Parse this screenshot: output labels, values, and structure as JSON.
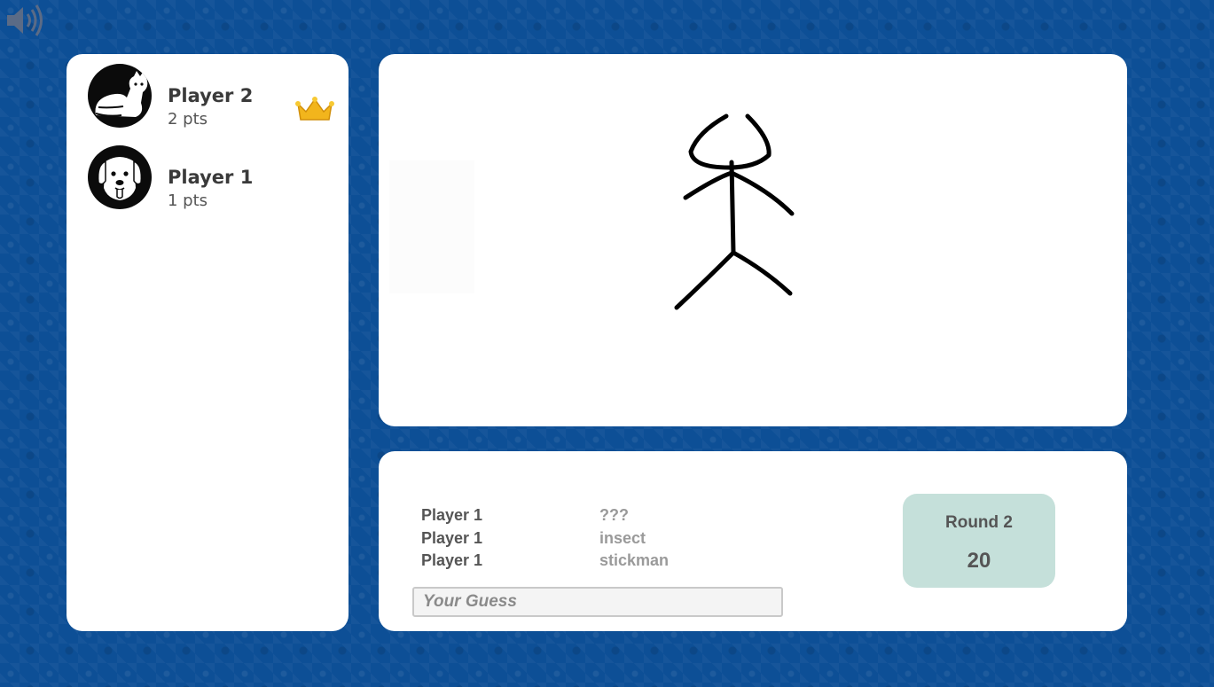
{
  "players": [
    {
      "name": "Player 2",
      "points": "2 pts",
      "avatar": "cat-icon",
      "leader": true
    },
    {
      "name": "Player 1",
      "points": "1 pts",
      "avatar": "dog-icon",
      "leader": false
    }
  ],
  "chat": [
    {
      "name": "Player 1",
      "text": "???"
    },
    {
      "name": "Player 1",
      "text": "insect"
    },
    {
      "name": "Player 1",
      "text": "stickman"
    }
  ],
  "guess": {
    "placeholder": "Your Guess",
    "value": ""
  },
  "round": {
    "label": "Round 2",
    "timer": "20"
  },
  "icons": {
    "sound": "speaker-icon",
    "leader": "crown-icon"
  },
  "colors": {
    "background": "#0d4f96",
    "panel": "#ffffff",
    "round_box": "#c5e0da",
    "crown": "#f2b51c"
  }
}
